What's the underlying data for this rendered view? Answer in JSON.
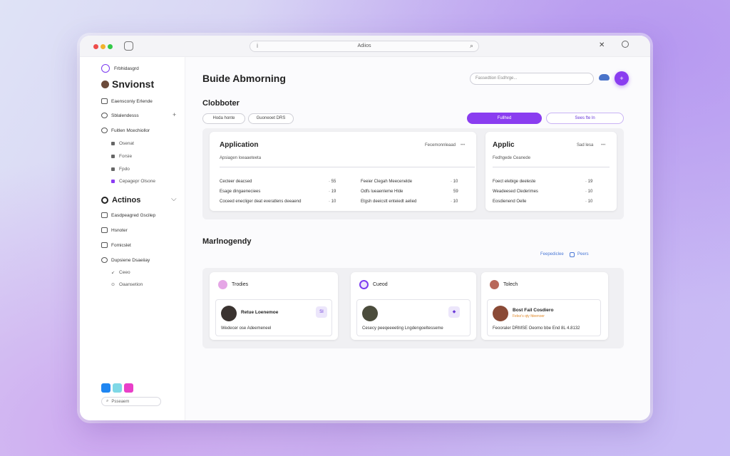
{
  "titlebar": {
    "address_text": "Adiios",
    "left_glyph": "i",
    "search_glyph": "⌕",
    "right_glyph": "✕"
  },
  "sidebar": {
    "brand_small": "Frbhidasgrd",
    "brand_name": "Snvionst",
    "items": [
      {
        "label": "Eaensconiy Erlende"
      },
      {
        "label": "Sblalendesss"
      },
      {
        "label": "Fuitlen Mcechiollor"
      }
    ],
    "subitems": [
      {
        "label": "Osenat"
      },
      {
        "label": "Forsie"
      },
      {
        "label": "Fpdo"
      },
      {
        "label": "Cepagepr Olsone"
      }
    ],
    "section_title": "Actinos",
    "section_items": [
      {
        "label": "Easdpeagred Gscilep"
      },
      {
        "label": "Hsnoter"
      },
      {
        "label": "Fomicslet"
      },
      {
        "label": "Dupsiene Dsaeiiay"
      }
    ],
    "section_subitems": [
      {
        "label": "Ceeo"
      },
      {
        "label": "Oaansetion"
      }
    ],
    "search_placeholder": "Psseaem",
    "swatch_colors": [
      "#1f86f2",
      "#7fd8e6",
      "#e93fc8"
    ]
  },
  "main": {
    "page_title": "Buide Abmorning",
    "search_placeholder": "Fassedtion Esdhrge...",
    "fab_label": "+",
    "section1_title": "Clobboter",
    "pill1": "Hoda honte",
    "pill2": "Guoneoet DRS",
    "primary_button": "Fullhed",
    "outline_button": "Sees fte ln",
    "card1": {
      "title": "Application",
      "meta": "Fecemonnleaad",
      "meta_dots": "•••",
      "subtitle": "Apsiagen loeaaeteeta",
      "left_rows": [
        {
          "label": "Cecteer deacsed",
          "value": "· 55"
        },
        {
          "label": "Esage dingaeneciees",
          "value": "· 19"
        },
        {
          "label": "Coceed enecliger deat everatlens deeaend",
          "value": "· 10"
        }
      ],
      "right_rows": [
        {
          "label": "Feeier Clegah Meecenelde",
          "value": "· 10"
        },
        {
          "label": "Odfs lueaenleme Hlde",
          "value": "59"
        },
        {
          "label": "Etgsh deeicstt enteiedt aelied",
          "value": "· 10"
        }
      ]
    },
    "card2": {
      "title": "Applic",
      "meta": "Sad lesa",
      "meta_dots": "•••",
      "subtitle": "Fedhgede Ceanede",
      "rows": [
        {
          "label": "Foect elebige deeleste",
          "value": "· 19"
        },
        {
          "label": "Weadeesed Clederimes",
          "value": "· 10"
        },
        {
          "label": "Eosdienend Oelle",
          "value": "· 10"
        }
      ]
    },
    "section2_title": "Marlnogendy",
    "link_text": "Feepediclee",
    "link_text2": "Peers",
    "people": [
      {
        "head": "Trodies",
        "name": "Retue Loenemoe",
        "tag": "",
        "badge": "SI",
        "foot": "Wedecer ose Adeemeneel",
        "head_color": "#e5a6e6",
        "avatar_color": "#3a3330"
      },
      {
        "head": "Cueod",
        "name": "",
        "tag": "",
        "badge": "◆",
        "foot": "Cesecy peeqeeeeting Lngdengoeltesseme",
        "head_color": "#7b3af0",
        "avatar_color": "#4b4c3c"
      },
      {
        "head": "Tolech",
        "name": "Bost Fail Cosdiero",
        "tag": "Felez’s qty fdeenoer",
        "badge": "",
        "foot": "Feooraler DRMSE Oeomo bbe End 8L 4.8132",
        "head_color": "#b8685a",
        "avatar_color": "#8a4a36"
      }
    ]
  }
}
